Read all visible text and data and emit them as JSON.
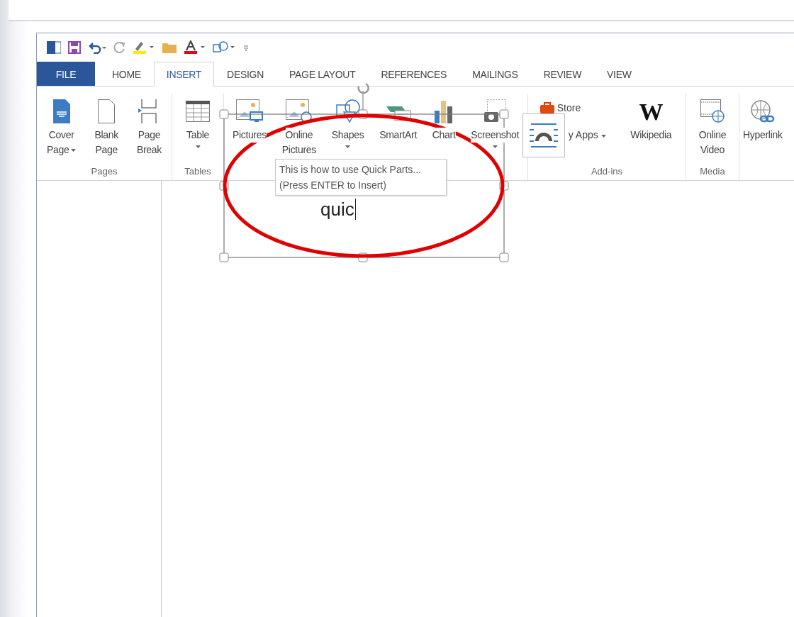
{
  "tabs": [
    {
      "label": "FILE",
      "kind": "file",
      "selected": false
    },
    {
      "label": "HOME",
      "kind": "tab",
      "selected": false
    },
    {
      "label": "INSERT",
      "kind": "tab",
      "selected": true
    },
    {
      "label": "DESIGN",
      "kind": "tab",
      "selected": false
    },
    {
      "label": "PAGE LAYOUT",
      "kind": "tab",
      "selected": false
    },
    {
      "label": "REFERENCES",
      "kind": "tab",
      "selected": false
    },
    {
      "label": "MAILINGS",
      "kind": "tab",
      "selected": false
    },
    {
      "label": "REVIEW",
      "kind": "tab",
      "selected": false
    },
    {
      "label": "VIEW",
      "kind": "tab",
      "selected": false
    }
  ],
  "ribbon": [
    {
      "label": "Pages",
      "buttons": [
        {
          "kind": "big",
          "lines": [
            "Cover",
            "Page"
          ],
          "dropdown": true
        },
        {
          "kind": "big",
          "lines": [
            "Blank",
            "Page"
          ],
          "dropdown": false
        },
        {
          "kind": "big",
          "lines": [
            "Page",
            "Break"
          ],
          "dropdown": false
        }
      ]
    },
    {
      "label": "Tables",
      "buttons": [
        {
          "kind": "big",
          "lines": [
            "Table"
          ],
          "dropdown": true
        }
      ]
    },
    {
      "buttons": [
        {
          "kind": "big",
          "lines": [
            "Pictures"
          ],
          "dropdown": false
        },
        {
          "kind": "big",
          "lines": [
            "Online",
            "Pictures"
          ],
          "dropdown": false
        },
        {
          "kind": "big",
          "lines": [
            "Shapes"
          ],
          "dropdown": true
        },
        {
          "kind": "big",
          "lines": [
            "SmartArt"
          ],
          "dropdown": false
        },
        {
          "kind": "big",
          "lines": [
            "Chart"
          ],
          "dropdown": false
        },
        {
          "kind": "big",
          "lines": [
            "Screenshot"
          ],
          "dropdown": true
        }
      ]
    },
    {
      "label": "Add-ins",
      "buttons": [
        {
          "kind": "stack",
          "items": [
            {
              "label": "Store",
              "dropdown": false
            },
            {
              "label": "y Apps",
              "dropdown": true
            }
          ]
        },
        {
          "kind": "big",
          "lines": [
            "Wikipedia"
          ],
          "glyph": "W",
          "dropdown": false
        }
      ]
    },
    {
      "label": "Media",
      "buttons": [
        {
          "kind": "big",
          "lines": [
            "Online",
            "Video"
          ],
          "dropdown": false
        }
      ]
    },
    {
      "buttons": [
        {
          "kind": "big",
          "lines": [
            "Hyperlink"
          ],
          "dropdown": false
        }
      ]
    }
  ],
  "tooltip": {
    "lines": [
      "This is how to use Quick Parts...",
      "(Press ENTER to Insert)"
    ]
  },
  "document": {
    "typed_text": "quic"
  }
}
